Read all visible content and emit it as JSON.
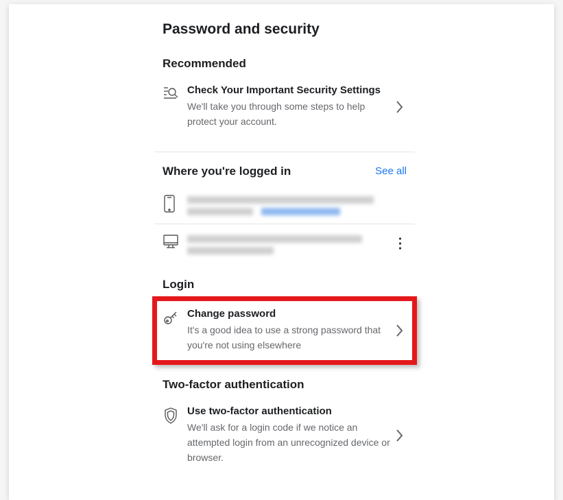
{
  "page_title": "Password and security",
  "recommended": {
    "title": "Recommended",
    "check": {
      "title": "Check Your Important Security Settings",
      "desc": "We'll take you through some steps to help protect your account."
    }
  },
  "sessions": {
    "title": "Where you're logged in",
    "see_all": "See all"
  },
  "login": {
    "title": "Login",
    "change_password": {
      "title": "Change password",
      "desc": "It's a good idea to use a strong password that you're not using elsewhere"
    }
  },
  "twofa": {
    "title": "Two-factor authentication",
    "use": {
      "title": "Use two-factor authentication",
      "desc": "We'll ask for a login code if we notice an attempted login from an unrecognized device or browser."
    }
  }
}
